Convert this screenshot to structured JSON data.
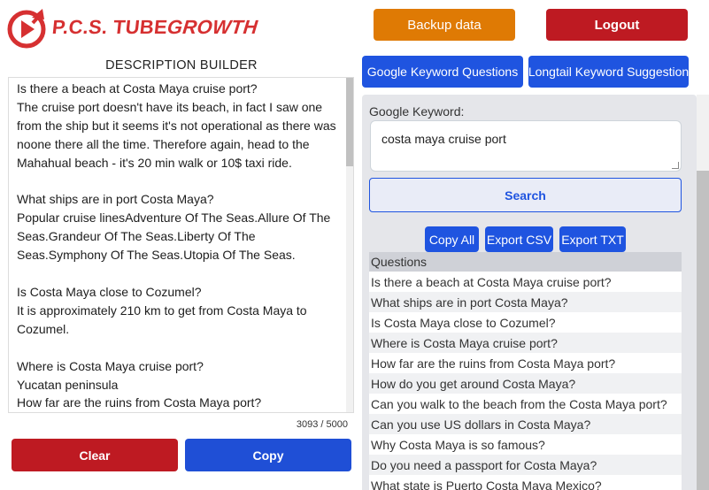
{
  "header": {
    "logo_text_prefix": "P.C.S. TUBE",
    "logo_text_suffix": "GROWTH",
    "backup_label": "Backup data",
    "logout_label": "Logout"
  },
  "builder": {
    "title": "DESCRIPTION BUILDER",
    "text": "Is there a beach at Costa Maya cruise port?\nThe cruise port doesn't have its beach, in fact I saw one from the ship but it seems it's not operational as there was noone there all the time. Therefore again, head to the Mahahual beach - it's 20 min walk or 10$ taxi ride.\n\nWhat ships are in port Costa Maya?\nPopular cruise linesAdventure Of The Seas.Allure Of The Seas.Grandeur Of The Seas.Liberty Of The Seas.Symphony Of The Seas.Utopia Of The Seas.\n\nIs Costa Maya close to Cozumel?\nIt is approximately 210 km to get from Costa Maya to Cozumel.\n\nWhere is Costa Maya cruise port?\nYucatan peninsula\nHow far are the ruins from Costa Maya port?",
    "counter": "3093 / 5000",
    "clear_label": "Clear",
    "copy_label": "Copy"
  },
  "tools": {
    "google_questions_label": "Google Keyword Questions",
    "longtail_label": "Longtail Keyword Suggestion",
    "keyword_label": "Google Keyword:",
    "keyword_value": "costa maya cruise port",
    "search_label": "Search",
    "copy_all_label": "Copy All",
    "export_csv_label": "Export CSV",
    "export_txt_label": "Export TXT",
    "questions_header": "Questions",
    "questions": [
      "Is there a beach at Costa Maya cruise port?",
      "What ships are in port Costa Maya?",
      "Is Costa Maya close to Cozumel?",
      "Where is Costa Maya cruise port?",
      "How far are the ruins from Costa Maya port?",
      "How do you get around Costa Maya?",
      "Can you walk to the beach from the Costa Maya port?",
      "Can you use US dollars in Costa Maya?",
      "Why Costa Maya is so famous?",
      "Do you need a passport for Costa Maya?",
      "What state is Puerto Costa Maya Mexico?"
    ]
  },
  "colors": {
    "brand_red": "#d63031",
    "backup_orange": "#df7a04",
    "danger_red": "#be1a22",
    "primary_blue": "#1f54e0"
  }
}
